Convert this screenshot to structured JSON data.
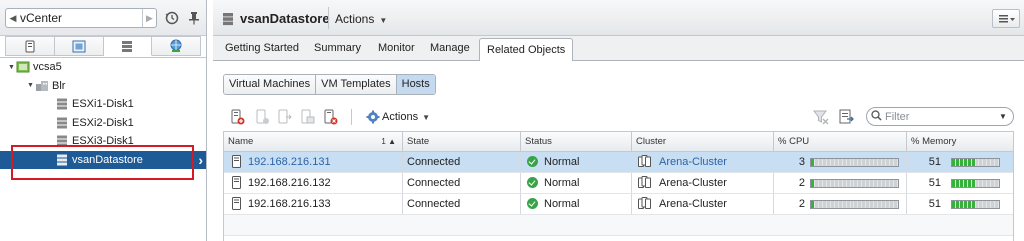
{
  "nav": {
    "back_label": "vCenter",
    "tree": [
      {
        "label": "vcsa5",
        "level": 0,
        "expanded": true,
        "icon": "vcenter-icon"
      },
      {
        "label": "Blr",
        "level": 1,
        "expanded": true,
        "icon": "datacenter-icon"
      },
      {
        "label": "ESXi1-Disk1",
        "level": 2,
        "icon": "datastore-icon"
      },
      {
        "label": "ESXi2-Disk1",
        "level": 2,
        "icon": "datastore-icon"
      },
      {
        "label": "ESXi3-Disk1",
        "level": 2,
        "icon": "datastore-icon"
      },
      {
        "label": "vsanDatastore",
        "level": 2,
        "icon": "datastore-icon",
        "selected": true
      }
    ],
    "highlight_color": "#d21c24"
  },
  "header": {
    "title": "vsanDatastore",
    "actions_label": "Actions"
  },
  "tabs": [
    "Getting Started",
    "Summary",
    "Monitor",
    "Manage",
    "Related Objects"
  ],
  "active_tab": "Related Objects",
  "subtabs": [
    "Virtual Machines",
    "VM Templates",
    "Hosts"
  ],
  "active_subtab": "Hosts",
  "toolbar": {
    "actions_label": "Actions",
    "filter_placeholder": "Filter"
  },
  "grid": {
    "columns": [
      "Name",
      "State",
      "Status",
      "Cluster",
      "% CPU",
      "% Memory"
    ],
    "sort_marker": "1",
    "rows": [
      {
        "name": "192.168.216.131",
        "state": "Connected",
        "status": "Normal",
        "cluster": "Arena-Cluster",
        "cpu": "3",
        "mem": "51",
        "selected": true
      },
      {
        "name": "192.168.216.132",
        "state": "Connected",
        "status": "Normal",
        "cluster": "Arena-Cluster",
        "cpu": "2",
        "mem": "51"
      },
      {
        "name": "192.168.216.133",
        "state": "Connected",
        "status": "Normal",
        "cluster": "Arena-Cluster",
        "cpu": "2",
        "mem": "51"
      }
    ]
  },
  "colors": {
    "selection": "#1e5a96",
    "row_selected": "#c8def3",
    "bar_green": "#38b03c",
    "link": "#2d63a8"
  }
}
